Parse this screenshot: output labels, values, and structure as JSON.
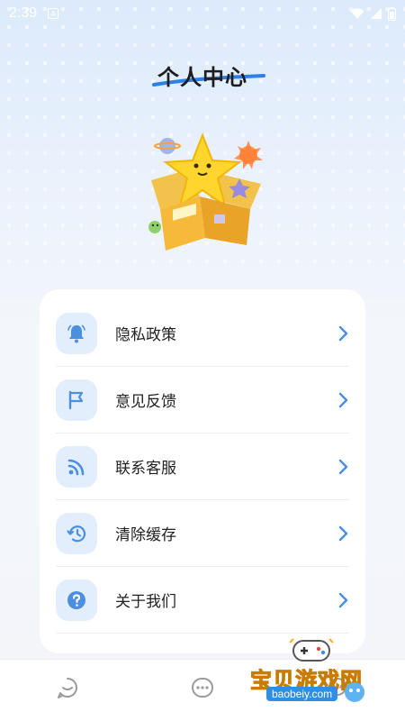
{
  "status_bar": {
    "time": "2:39",
    "notification_letter": "A"
  },
  "header": {
    "title": "个人中心"
  },
  "menu": {
    "items": [
      {
        "label": "隐私政策",
        "icon": "bell-icon"
      },
      {
        "label": "意见反馈",
        "icon": "flag-icon"
      },
      {
        "label": "联系客服",
        "icon": "rss-icon"
      },
      {
        "label": "清除缓存",
        "icon": "history-icon"
      },
      {
        "label": "关于我们",
        "icon": "help-icon"
      }
    ]
  },
  "bottom_nav": {
    "items": [
      "chat-bubble-icon",
      "more-dots-icon",
      "profile-icon"
    ]
  },
  "watermark": {
    "text": "宝贝游戏网",
    "url": "baobeiy.com"
  },
  "colors": {
    "accent": "#4a8fe0",
    "icon_bg": "#e2eefb",
    "title_underline": "#2f7fe6"
  }
}
